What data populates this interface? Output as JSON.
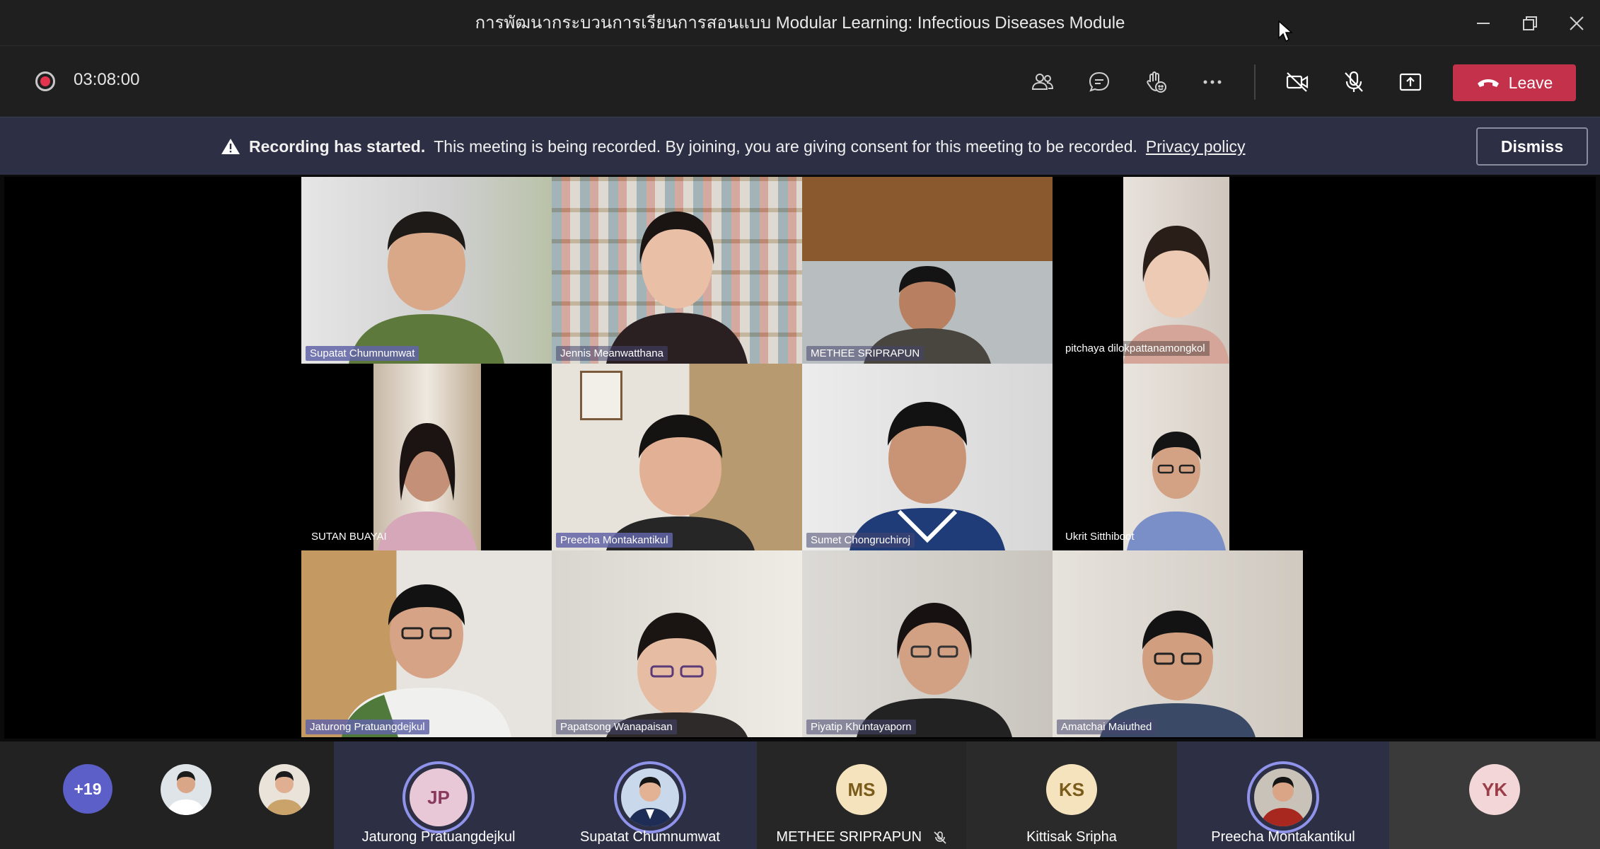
{
  "window": {
    "title": "การพัฒนากระบวนการเรียนการสอนแบบ Modular Learning: Infectious Diseases Module"
  },
  "toolbar": {
    "timer": "03:08:00",
    "leave_label": "Leave"
  },
  "banner": {
    "bold": "Recording has started.",
    "text": "This meeting is being recorded. By joining, you are giving consent for this meeting to be recorded.",
    "link": "Privacy policy",
    "dismiss_label": "Dismiss"
  },
  "tiles": [
    {
      "name": "Supatat Chumnumwat",
      "active": true
    },
    {
      "name": "Jennis Meanwatthana"
    },
    {
      "name": "METHEE SRIPRAPUN"
    },
    {
      "name": "pitchaya dilokpattanamongkol"
    },
    {
      "name": "SUTAN BUAYAI"
    },
    {
      "name": "Preecha Montakantikul",
      "active": true
    },
    {
      "name": "Sumet Chongruchiroj"
    },
    {
      "name": "Ukrit Sitthiboot"
    },
    {
      "name": "Jaturong Pratuangdejkul",
      "active": true
    },
    {
      "name": "Papatsong Wanapaisan"
    },
    {
      "name": "Piyatip Khuntayaporn"
    },
    {
      "name": "Amatchai Maiuthed"
    }
  ],
  "strip": {
    "more_count": "+19",
    "participants": [
      {
        "initials": "JP",
        "name": "Jaturong Pratuangdejkul",
        "color": "#e8c8d6",
        "text_color": "#8a3a5e",
        "speaking": true
      },
      {
        "initials": "",
        "name": "Supatat Chumnumwat",
        "speaking": true
      },
      {
        "initials": "MS",
        "name": "METHEE SRIPRAPUN",
        "color": "#f4e3bd",
        "text_color": "#7a5b1a",
        "muted": true
      },
      {
        "initials": "KS",
        "name": "Kittisak Sripha",
        "color": "#f4e3bd",
        "text_color": "#7a5b1a"
      },
      {
        "initials": "",
        "name": "Preecha Montakantikul",
        "speaking": true
      },
      {
        "initials": "YK",
        "name": "",
        "color": "#f3d6d8",
        "text_color": "#9b3d49"
      }
    ]
  }
}
